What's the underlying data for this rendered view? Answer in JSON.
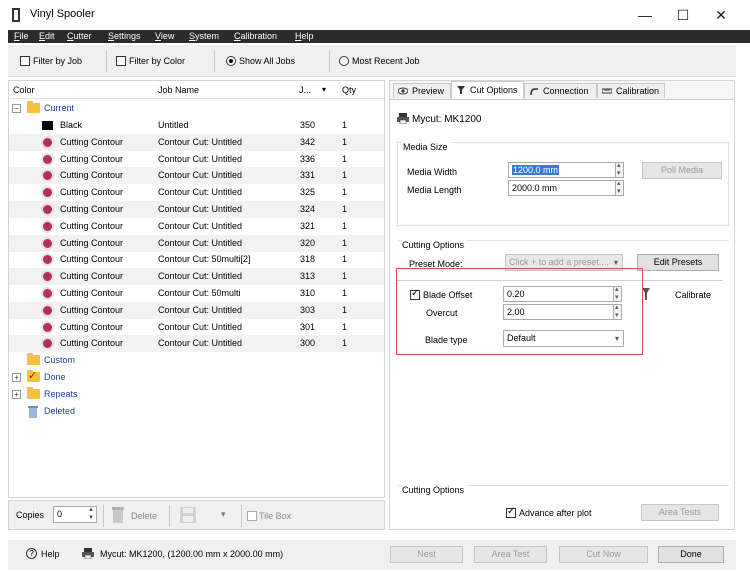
{
  "window": {
    "title": "Vinyl Spooler",
    "minimize": "—",
    "maximize": "☐",
    "close": "✕"
  },
  "menu": {
    "items": [
      "File",
      "Edit",
      "Cutter",
      "Settings",
      "View",
      "System",
      "Calibration",
      "Help"
    ]
  },
  "filters": {
    "filter_by_job": "Filter by Job",
    "filter_by_color": "Filter by Color",
    "show_all_jobs": "Show All Jobs",
    "most_recent_job": "Most Recent Job",
    "selected": "Show All Jobs"
  },
  "job_table": {
    "columns": {
      "color": "Color",
      "job_name": "Job Name",
      "job_no": "J...",
      "qty": "Qty"
    },
    "tree": {
      "current": "Current",
      "custom": "Custom",
      "done": "Done",
      "repeats": "Repeats",
      "deleted": "Deleted"
    },
    "rows": [
      {
        "color": "Black",
        "job_name": "Untitled",
        "job_no": "350",
        "qty": "1",
        "icon": "black-swatch"
      },
      {
        "color": "Cutting Contour",
        "job_name": "Contour Cut: Untitled",
        "job_no": "342",
        "qty": "1",
        "icon": "cut-contour-icon"
      },
      {
        "color": "Cutting Contour",
        "job_name": "Contour Cut: Untitled",
        "job_no": "336",
        "qty": "1",
        "icon": "cut-contour-icon"
      },
      {
        "color": "Cutting Contour",
        "job_name": "Contour Cut: Untitled",
        "job_no": "331",
        "qty": "1",
        "icon": "cut-contour-icon"
      },
      {
        "color": "Cutting Contour",
        "job_name": "Contour Cut: Untitled",
        "job_no": "325",
        "qty": "1",
        "icon": "cut-contour-icon"
      },
      {
        "color": "Cutting Contour",
        "job_name": "Contour Cut: Untitled",
        "job_no": "324",
        "qty": "1",
        "icon": "cut-contour-icon"
      },
      {
        "color": "Cutting Contour",
        "job_name": "Contour Cut: Untitled",
        "job_no": "321",
        "qty": "1",
        "icon": "cut-contour-icon"
      },
      {
        "color": "Cutting Contour",
        "job_name": "Contour Cut: Untitled",
        "job_no": "320",
        "qty": "1",
        "icon": "cut-contour-icon"
      },
      {
        "color": "Cutting Contour",
        "job_name": "Contour Cut: 50multi[2]",
        "job_no": "318",
        "qty": "1",
        "icon": "cut-contour-icon"
      },
      {
        "color": "Cutting Contour",
        "job_name": "Contour Cut: Untitled",
        "job_no": "313",
        "qty": "1",
        "icon": "cut-contour-icon"
      },
      {
        "color": "Cutting Contour",
        "job_name": "Contour Cut: 50multi",
        "job_no": "310",
        "qty": "1",
        "icon": "cut-contour-icon"
      },
      {
        "color": "Cutting Contour",
        "job_name": "Contour Cut: Untitled",
        "job_no": "303",
        "qty": "1",
        "icon": "cut-contour-icon"
      },
      {
        "color": "Cutting Contour",
        "job_name": "Contour Cut: Untitled",
        "job_no": "301",
        "qty": "1",
        "icon": "cut-contour-icon"
      },
      {
        "color": "Cutting Contour",
        "job_name": "Contour Cut: Untitled",
        "job_no": "300",
        "qty": "1",
        "icon": "cut-contour-icon"
      }
    ]
  },
  "left_toolbar": {
    "copies_label": "Copies",
    "copies_value": "0",
    "delete_label": "Delete",
    "tile_box_label": "Tile Box"
  },
  "status": {
    "help_label": "Help",
    "device_info": "Mycut: MK1200,  (1200.00 mm x 2000.00 mm)",
    "nest": "Nest",
    "area_test": "Area Test",
    "cut_now": "Cut Now",
    "done": "Done"
  },
  "tabs": [
    {
      "label": "Preview",
      "active": false
    },
    {
      "label": "Cut Options",
      "active": true
    },
    {
      "label": "Connection",
      "active": false
    },
    {
      "label": "Calibration",
      "active": false
    }
  ],
  "cut_options": {
    "device_name": "Mycut: MK1200",
    "media_size_heading": "Media Size",
    "media_width_label": "Media Width",
    "media_width_value": "1200.0 mm",
    "media_length_label": "Media Length",
    "media_length_value": "2000.0 mm",
    "poll_media": "Poll Media",
    "cutting_options_heading": "Cutting Options",
    "preset_mode_label": "Preset Mode:",
    "preset_placeholder": "Click + to add a preset....",
    "edit_presets": "Edit Presets",
    "blade_offset_label": "Blade Offset",
    "blade_offset_value": "0.20",
    "overcut_label": "Overcut",
    "overcut_value": "2.00",
    "calibrate": "Calibrate",
    "blade_type_label": "Blade type",
    "blade_type_value": "Default",
    "cutting_options_bottom_heading": "Cutting Options",
    "advance_after_plot": "Advance after plot",
    "area_tests": "Area Tests"
  },
  "colors": {
    "menu_bg": "#2b2b2b",
    "highlight": "#3a78d4",
    "annotation_red": "#e24b4b",
    "tree_link": "#1a3fa0"
  }
}
